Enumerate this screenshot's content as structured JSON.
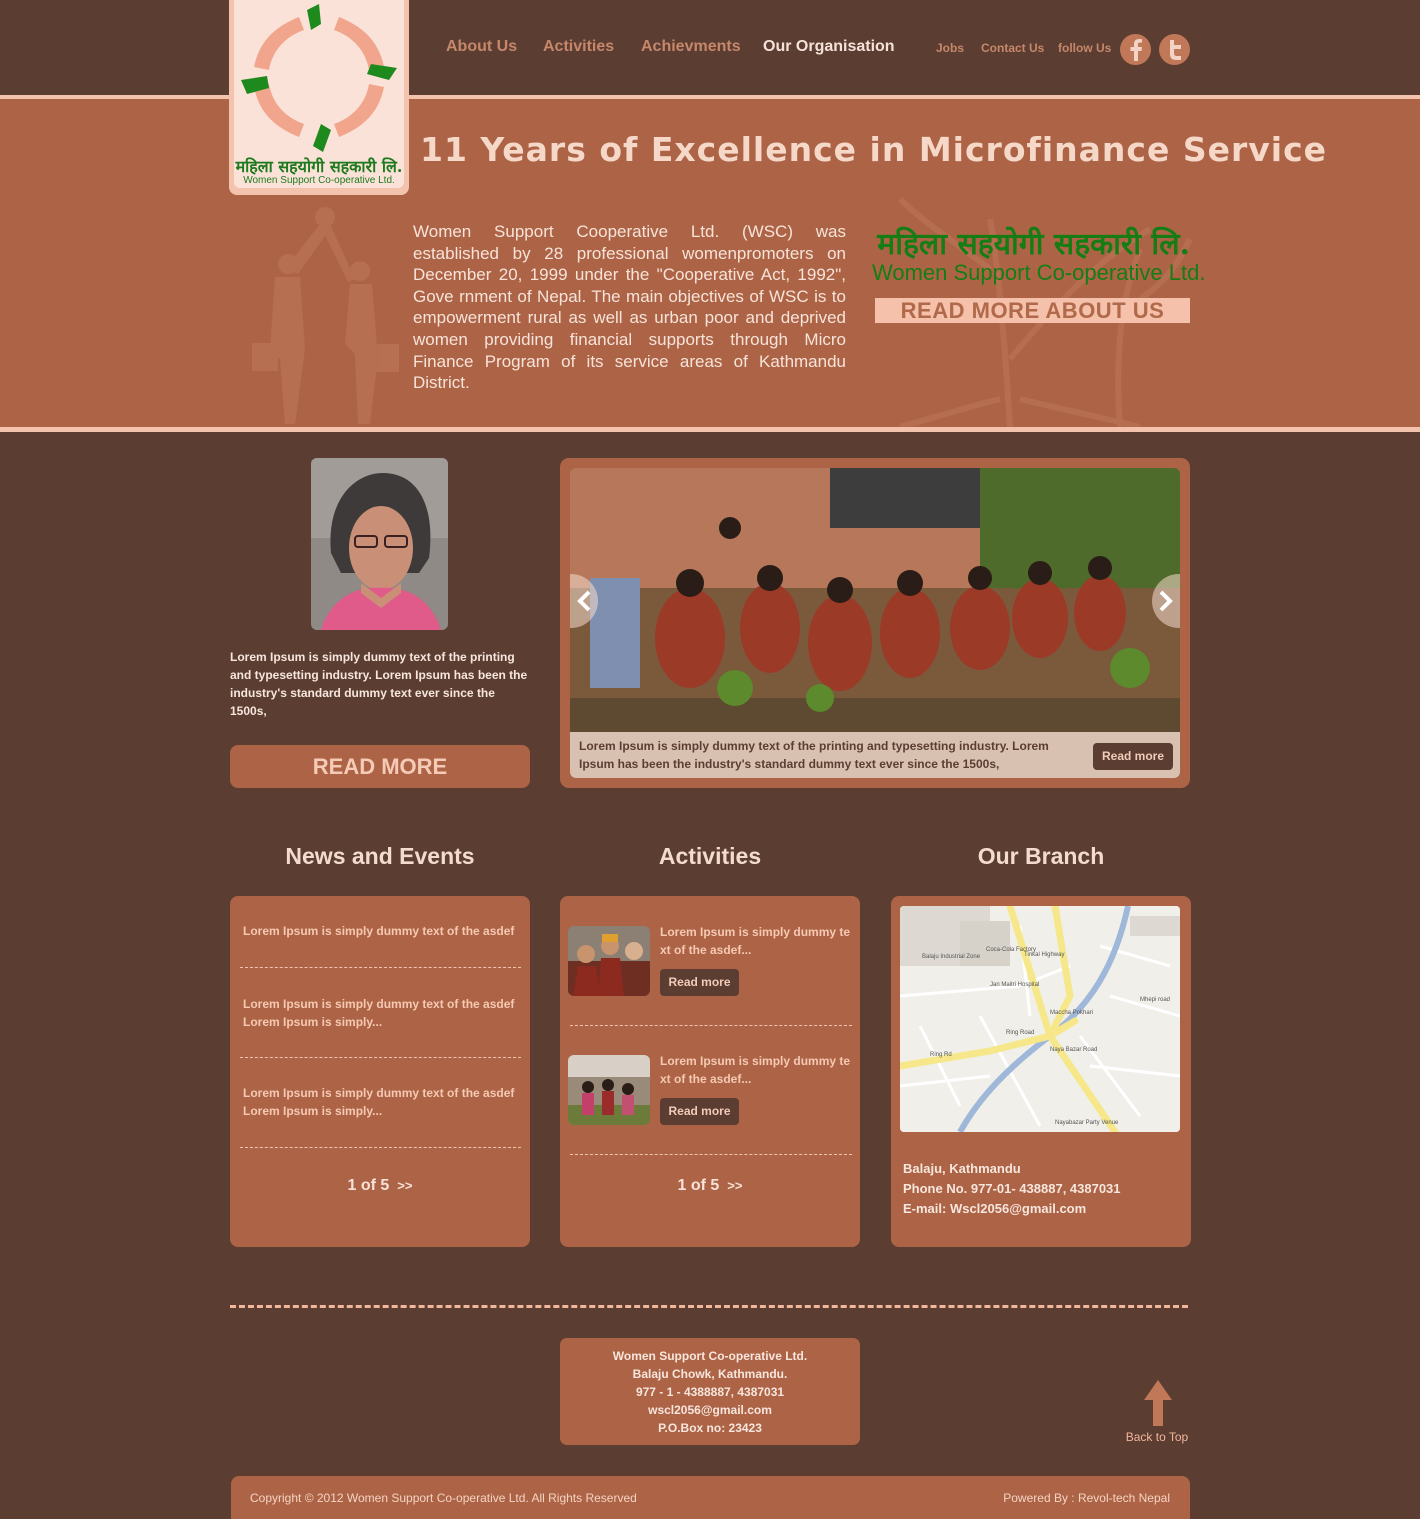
{
  "nav": {
    "items": [
      "About Us",
      "Activities",
      "Achievments",
      "Our Organisation"
    ],
    "sub_items": [
      "Jobs",
      "Contact Us",
      "follow Us"
    ],
    "social": [
      "facebook-icon",
      "twitter-icon"
    ]
  },
  "logo": {
    "np": "महिला सहयोगी सहकारी लि.",
    "en": "Women Support Co-operative Ltd."
  },
  "hero": {
    "title": "11 Years of Excellence in Microfinance Service",
    "text": "Women Support Cooperative Ltd. (WSC) was established by 28 professional womenpromoters on December 20, 1999 under the \"Cooperative Act, 1992\", Gove  rnment of Nepal. The main objectives of WSC is to empowerment rural as well as urban poor and deprived women providing financial supports through Micro Finance Program of its service areas of Kathmandu District.",
    "np_name": "महिला सहयोगी सहकारी लि.",
    "en_name": "Women Support Co-operative Ltd.",
    "read_more": "READ MORE ABOUT US"
  },
  "profile": {
    "text": "Lorem Ipsum is simply dummy text of the printing and typesetting industry. Lorem Ipsum has been the industry's standard dummy text ever since the 1500s,",
    "read_more": "READ MORE"
  },
  "slider": {
    "caption": "Lorem Ipsum is simply dummy text of the printing and typesetting industry. Lorem Ipsum has been the industry's standard dummy text ever since the 1500s,",
    "read_more": "Read more"
  },
  "news": {
    "title": "News and Events",
    "items": [
      "Lorem Ipsum is simply dummy text of the asdef",
      "Lorem Ipsum is simply dummy text of the asdef Lorem Ipsum is simply...",
      "Lorem Ipsum is simply dummy text of the asdef Lorem Ipsum is simply..."
    ],
    "pager": "1 of 5",
    "next": ">>"
  },
  "activities": {
    "title": "Activities",
    "items": [
      {
        "text": "Lorem Ipsum is simply dummy text of the asdef...",
        "button": "Read more"
      },
      {
        "text": "Lorem Ipsum is simply dummy text of the asdef...",
        "button": "Read more"
      }
    ],
    "pager": "1 of 5",
    "next": ">>"
  },
  "branch": {
    "title": "Our Branch",
    "address": "Balaju, Kathmandu",
    "phone": "Phone No. 977-01- 438887, 4387031",
    "email": "E-mail: Wscl2056@gmail.com",
    "map_labels": [
      "Balaju Industrial Zone",
      "Coca-Cola Factory",
      "Jan Maitri Hospital",
      "Ring Rd",
      "Ring Road",
      "Tinkal Highway",
      "Naya Bazar Road",
      "Maccha Pokhari",
      "Nayabazar Party Venue",
      "Mhepi road"
    ]
  },
  "footer": {
    "contact": [
      "Women Support Co-operative Ltd.",
      "Balaju Chowk, Kathmandu.",
      "977 - 1 - 4388887, 4387031",
      "wscl2056@gmail.com",
      "P.O.Box no: 23423"
    ],
    "back_to_top": "Back to Top",
    "copyright": "Copyright © 2012 Women Support Co-operative Ltd. All Rights Reserved",
    "powered": "Powered By : Revol-tech Nepal"
  },
  "colors": {
    "background": "#5b3d32",
    "accent": "#ad6446",
    "light": "#f3c3ae",
    "logo_green": "#157d14"
  }
}
